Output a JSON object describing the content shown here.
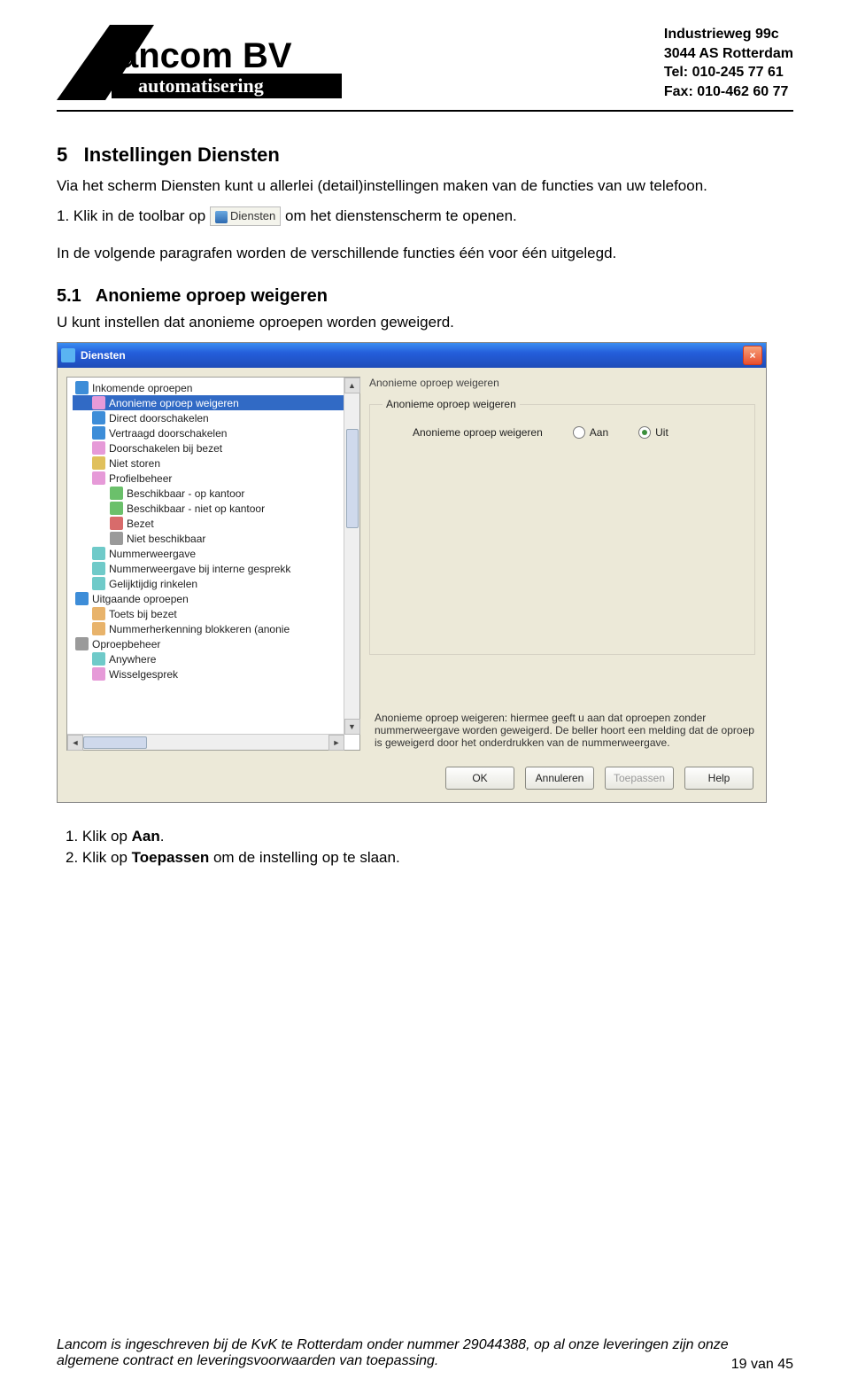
{
  "header": {
    "address": [
      "Industrieweg 99c",
      "3044 AS Rotterdam",
      "Tel: 010-245 77 61",
      "Fax: 010-462 60 77"
    ],
    "logo_top": "ancom BV",
    "logo_bottom": "automatisering"
  },
  "section": {
    "number": "5",
    "title": "Instellingen Diensten",
    "intro": "Via het scherm Diensten kunt u allerlei (detail)instellingen maken van de functies van uw telefoon.",
    "list1_prefix": "1.  Klik in de toolbar op ",
    "toolbar_button_label": "Diensten",
    "list1_suffix": " om het dienstenscherm te openen.",
    "intro2": "In de volgende paragrafen worden de verschillende functies één voor één uitgelegd.",
    "sub_number": "5.1",
    "sub_title": "Anonieme oproep weigeren",
    "sub_intro": "U kunt instellen dat anonieme oproepen worden geweigerd."
  },
  "screenshot": {
    "window_title": "Diensten",
    "tree_items": [
      {
        "label": "Inkomende oproepen",
        "indent": 0,
        "icon": "c-blue"
      },
      {
        "label": "Anonieme oproep weigeren",
        "indent": 1,
        "icon": "c-pink",
        "selected": true
      },
      {
        "label": "Direct doorschakelen",
        "indent": 1,
        "icon": "c-blue"
      },
      {
        "label": "Vertraagd doorschakelen",
        "indent": 1,
        "icon": "c-blue"
      },
      {
        "label": "Doorschakelen bij bezet",
        "indent": 1,
        "icon": "c-pink"
      },
      {
        "label": "Niet storen",
        "indent": 1,
        "icon": "c-yellow"
      },
      {
        "label": "Profielbeheer",
        "indent": 1,
        "icon": "c-pink"
      },
      {
        "label": "Beschikbaar - op kantoor",
        "indent": 2,
        "icon": "c-green"
      },
      {
        "label": "Beschikbaar - niet op kantoor",
        "indent": 2,
        "icon": "c-green"
      },
      {
        "label": "Bezet",
        "indent": 2,
        "icon": "c-red"
      },
      {
        "label": "Niet beschikbaar",
        "indent": 2,
        "icon": "c-grey"
      },
      {
        "label": "Nummerweergave",
        "indent": 1,
        "icon": "c-teal"
      },
      {
        "label": "Nummerweergave bij interne gesprekk",
        "indent": 1,
        "icon": "c-teal"
      },
      {
        "label": "Gelijktijdig rinkelen",
        "indent": 1,
        "icon": "c-teal"
      },
      {
        "label": "Uitgaande oproepen",
        "indent": 0,
        "icon": "c-blue"
      },
      {
        "label": "Toets bij bezet",
        "indent": 1,
        "icon": "c-orange"
      },
      {
        "label": "Nummerherkenning blokkeren (anonie",
        "indent": 1,
        "icon": "c-orange"
      },
      {
        "label": "Oproepbeheer",
        "indent": 0,
        "icon": "c-grey"
      },
      {
        "label": "Anywhere",
        "indent": 1,
        "icon": "c-teal"
      },
      {
        "label": "Wisselgesprek",
        "indent": 1,
        "icon": "c-pink"
      }
    ],
    "pane_title": "Anonieme oproep weigeren",
    "group_legend": "Anonieme oproep weigeren",
    "row_label": "Anonieme oproep weigeren",
    "radio_on": "Aan",
    "radio_off": "Uit",
    "description": "Anonieme oproep weigeren: hiermee geeft u aan dat oproepen zonder nummerweergave worden geweigerd. De beller hoort een melding dat de oproep is geweigerd door het onderdrukken van de nummerweergave.",
    "buttons": [
      "OK",
      "Annuleren",
      "Toepassen",
      "Help"
    ]
  },
  "steps": {
    "s1_prefix": "1.  Klik op ",
    "s1_bold": "Aan",
    "s1_suffix": ".",
    "s2_prefix": "2.  Klik op ",
    "s2_bold": "Toepassen",
    "s2_suffix": " om de instelling op te slaan."
  },
  "footer": {
    "text": "Lancom is ingeschreven bij de KvK te Rotterdam onder nummer 29044388, op al onze leveringen zijn onze algemene contract en leveringsvoorwaarden van toepassing.",
    "page": "19 van 45"
  }
}
